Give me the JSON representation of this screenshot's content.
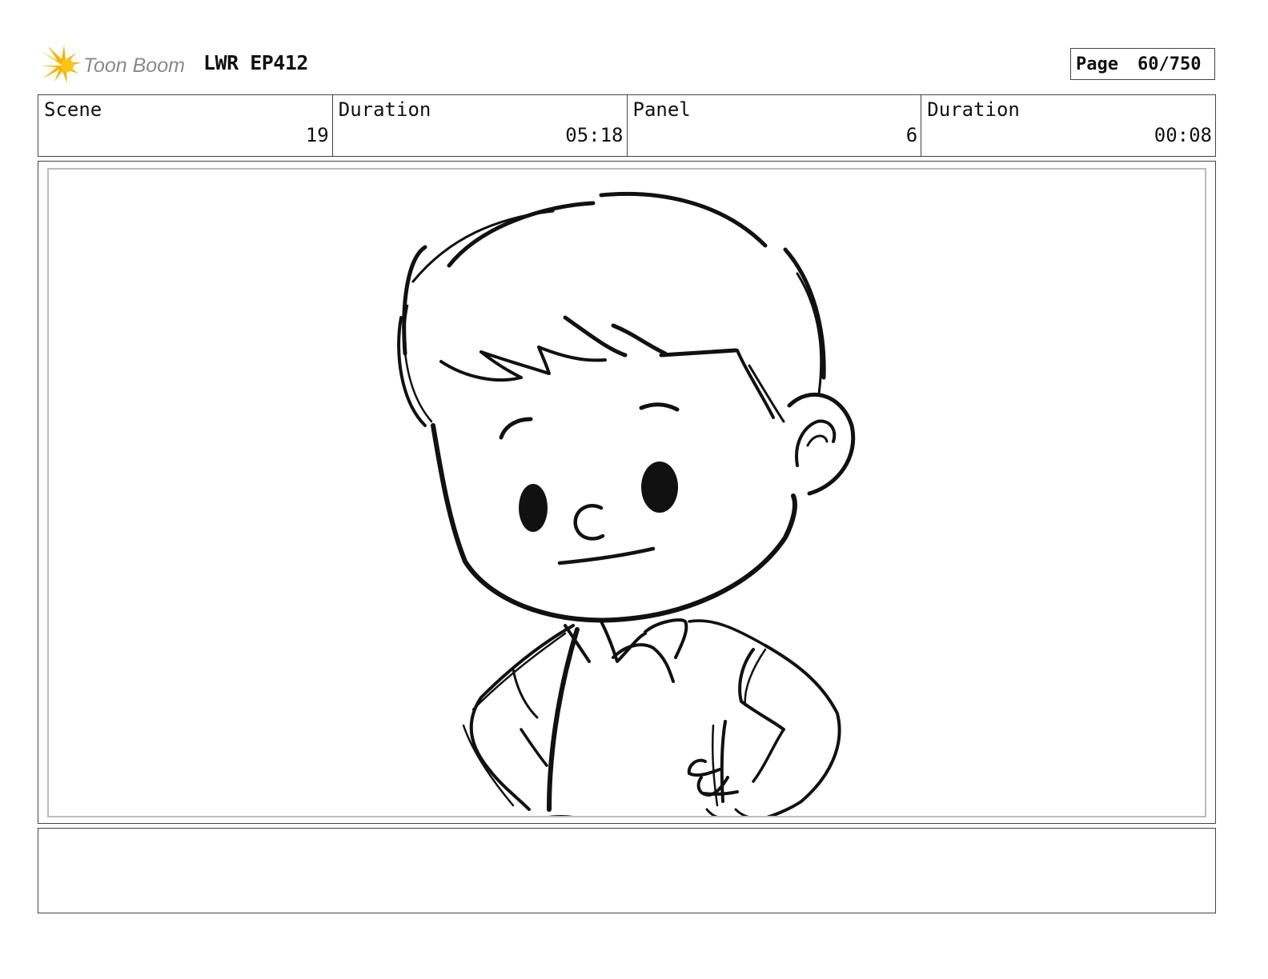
{
  "header": {
    "logo_text": "Toon Boom",
    "project": "LWR EP412",
    "page_label": "Page",
    "page_value": "60/750"
  },
  "info": {
    "scene_label": "Scene",
    "scene_value": "19",
    "scene_duration_label": "Duration",
    "scene_duration_value": "05:18",
    "panel_label": "Panel",
    "panel_value": "6",
    "panel_duration_label": "Duration",
    "panel_duration_value": "00:08"
  },
  "notes": {
    "text": ""
  },
  "colors": {
    "logo_star": "#f5b400",
    "logo_text": "#8a8a8a",
    "border": "#444444",
    "inner_border": "#bbbbbb"
  }
}
